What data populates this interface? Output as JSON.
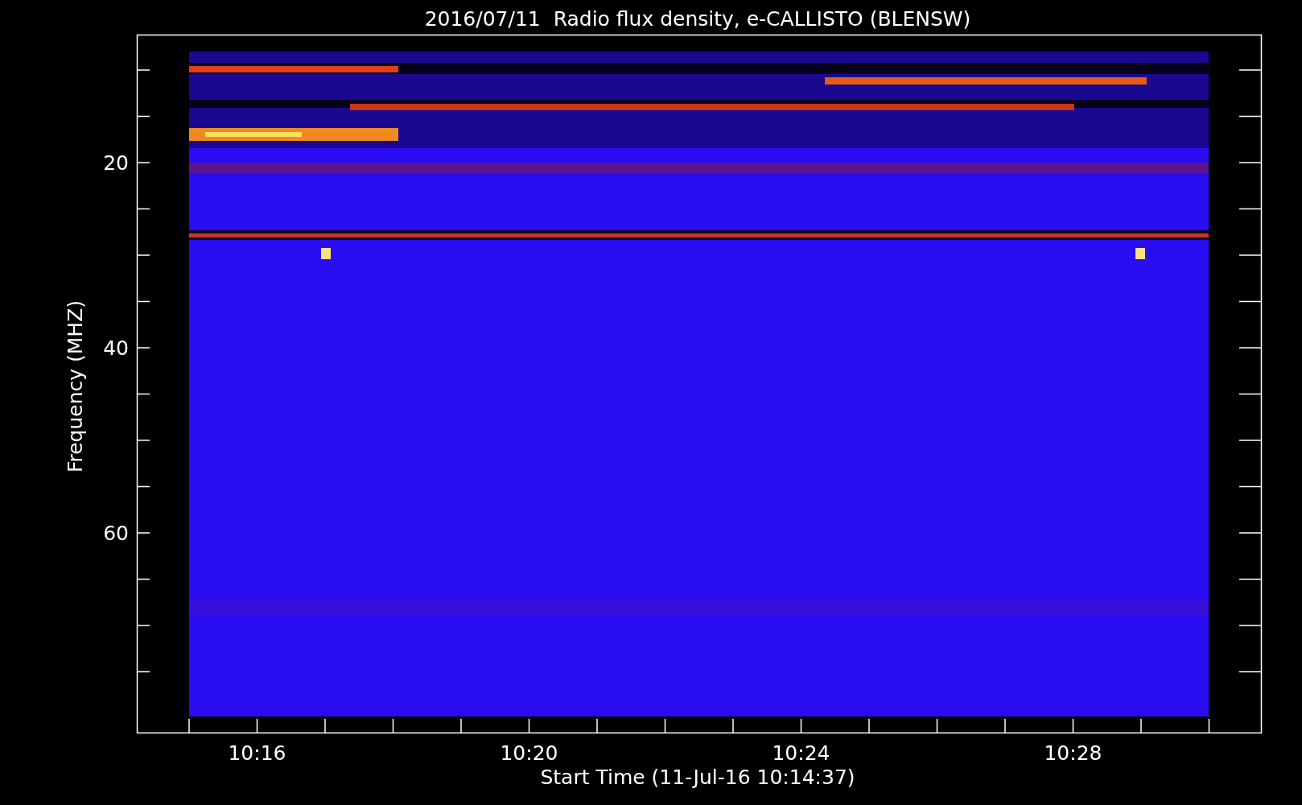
{
  "chart": {
    "title": "2016/07/11  Radio flux density, e-CALLISTO (BLENSW)",
    "y_axis": {
      "label": "Frequency (MHZ)",
      "tick_labels": [
        "20",
        "40",
        "60"
      ]
    },
    "x_axis": {
      "label": "Start Time (11-Jul-16 10:14:37)",
      "tick_labels": [
        "10:16",
        "10:20",
        "10:24",
        "10:28"
      ]
    }
  }
}
